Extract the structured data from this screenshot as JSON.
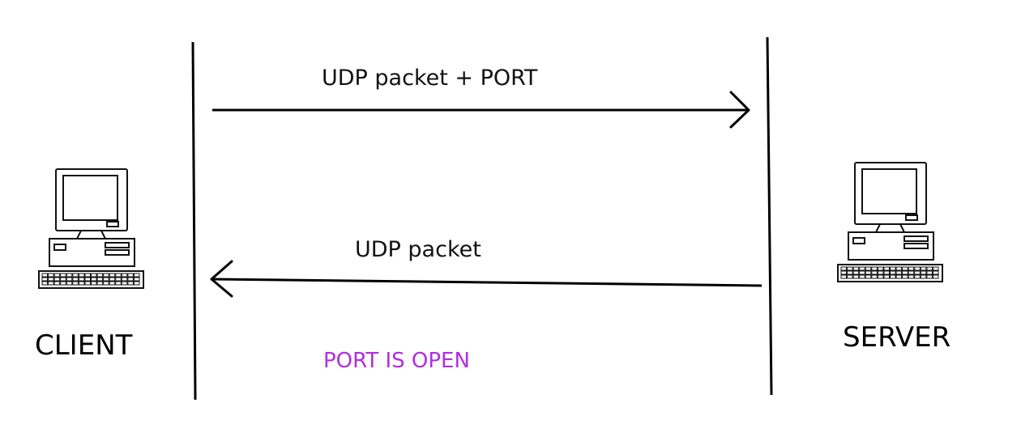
{
  "messages": [
    {
      "label": "UDP packet + PORT",
      "direction": "client-to-server"
    },
    {
      "label": "UDP packet",
      "direction": "server-to-client"
    }
  ],
  "nodes": {
    "client": {
      "label": "CLIENT",
      "icon": "computer-icon"
    },
    "server": {
      "label": "SERVER",
      "icon": "computer-icon"
    }
  },
  "status": {
    "label": "PORT IS OPEN",
    "color": "#b02ee0"
  }
}
